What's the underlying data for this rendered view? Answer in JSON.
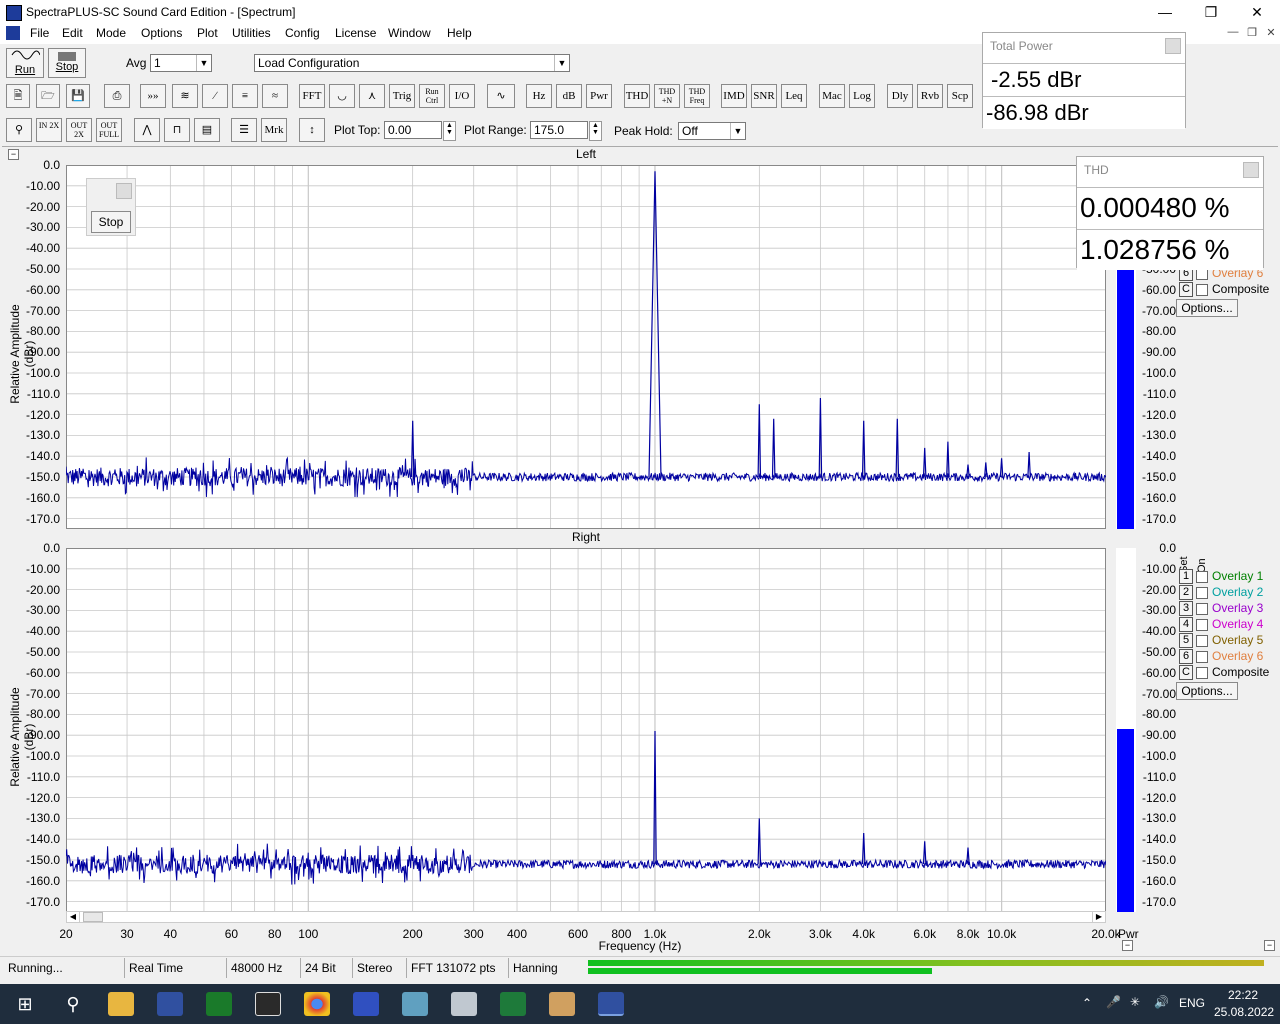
{
  "window": {
    "title": "SpectraPLUS-SC Sound Card Edition - [Spectrum]"
  },
  "menu": [
    "File",
    "Edit",
    "Mode",
    "Options",
    "Plot",
    "Utilities",
    "Config",
    "License",
    "Window",
    "Help"
  ],
  "toolbar1": {
    "run": "Run",
    "stop": "Stop",
    "avg_label": "Avg",
    "avg_value": "1",
    "config_value": "Load Configuration"
  },
  "toolbar2_buttons": [
    "FFT",
    "Trig",
    "Run Ctrl",
    "I/O",
    "Hz",
    "dB",
    "Pwr",
    "THD",
    "THD +N",
    "THD Freq",
    "IMD",
    "SNR",
    "Leq",
    "Mac",
    "Log",
    "Dly",
    "Rvb",
    "Scp"
  ],
  "toolbar3": {
    "in_btn": "IN 2X",
    "out_btn": "OUT 2X",
    "out_full": "OUT FULL",
    "mrk": "Mrk",
    "plot_top_label": "Plot Top:",
    "plot_top_value": "0.00",
    "plot_range_label": "Plot Range:",
    "plot_range_value": "175.0",
    "peak_hold_label": "Peak Hold:",
    "peak_hold_value": "Off"
  },
  "total_power": {
    "title": "Total Power",
    "left": "-2.55 dBr",
    "right": "-86.98 dBr"
  },
  "thd": {
    "title": "THD",
    "left": "0.000480 %",
    "right": "1.028756 %"
  },
  "stop_popup": {
    "label": "Stop"
  },
  "plots": {
    "left_title": "Left",
    "right_title": "Right",
    "ylabel": "Relative Amplitude (dBr)",
    "xlabel": "Frequency (Hz)",
    "y_ticks": [
      "0.0",
      "-10.00",
      "-20.00",
      "-30.00",
      "-40.00",
      "-50.00",
      "-60.00",
      "-70.00",
      "-80.00",
      "-90.00",
      "-100.0",
      "-110.0",
      "-120.0",
      "-130.0",
      "-140.0",
      "-150.0",
      "-160.0",
      "-170.0"
    ],
    "x_ticks": [
      "20",
      "30",
      "40",
      "60",
      "80",
      "100",
      "200",
      "300",
      "400",
      "600",
      "800",
      "1.0k",
      "2.0k",
      "3.0k",
      "4.0k",
      "6.0k",
      "8.0k",
      "10.0k",
      "20.0k"
    ],
    "pwr_label": "Pwr",
    "set_label": "Set",
    "on_label": "On",
    "overlays": [
      {
        "set": "1",
        "name": "Overlay 1",
        "color": "#008000"
      },
      {
        "set": "2",
        "name": "Overlay 2",
        "color": "#00a0a0"
      },
      {
        "set": "3",
        "name": "Overlay 3",
        "color": "#9900cc"
      },
      {
        "set": "4",
        "name": "Overlay 4",
        "color": "#cc00cc"
      },
      {
        "set": "5",
        "name": "Overlay 5",
        "color": "#806000"
      },
      {
        "set": "6",
        "name": "Overlay 6",
        "color": "#e08040"
      },
      {
        "set": "C",
        "name": "Composite",
        "color": "#000000"
      }
    ],
    "options_label": "Options..."
  },
  "chart_data": [
    {
      "type": "line",
      "title": "Left",
      "xlabel": "Frequency (Hz)",
      "ylabel": "Relative Amplitude (dBr)",
      "xscale": "log",
      "xlim": [
        20,
        20000
      ],
      "ylim": [
        -175,
        0
      ],
      "noise_floor_dBr": -150,
      "series": [
        {
          "x": [
            20,
            200,
            1000,
            2000,
            2200,
            3000,
            4000,
            5000,
            6000,
            7000,
            8000,
            9000,
            10000,
            12000
          ],
          "y": [
            -145,
            -123,
            -3,
            -115,
            -122,
            -112,
            -123,
            -122,
            -136,
            -133,
            -144,
            -143,
            -141,
            -138
          ]
        }
      ],
      "power_bar_dBr": -2.55
    },
    {
      "type": "line",
      "title": "Right",
      "xlabel": "Frequency (Hz)",
      "ylabel": "Relative Amplitude (dBr)",
      "xscale": "log",
      "xlim": [
        20,
        20000
      ],
      "ylim": [
        -175,
        0
      ],
      "noise_floor_dBr": -152,
      "series": [
        {
          "x": [
            20,
            1000,
            2000,
            4000,
            6000,
            8000
          ],
          "y": [
            -148,
            -88,
            -130,
            -137,
            -141,
            -144
          ]
        }
      ],
      "power_bar_dBr": -86.98
    }
  ],
  "status": [
    "Running...",
    "Real Time",
    "48000 Hz",
    "24 Bit",
    "Stereo",
    "FFT 131072 pts",
    "Hanning"
  ],
  "tray": {
    "lang": "ENG",
    "time": "22:22",
    "date": "25.08.2022"
  },
  "colors": {
    "trace": "#0000a0",
    "bar": "#0000ff",
    "grid": "#c8c8c8"
  }
}
